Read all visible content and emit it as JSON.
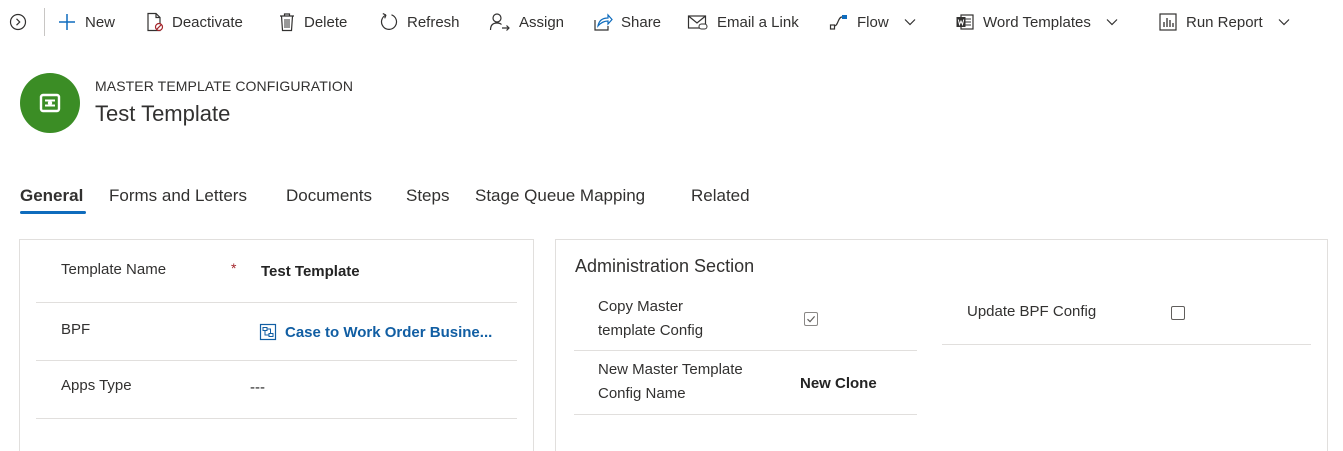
{
  "toolbar": {
    "new_label": "New",
    "deactivate_label": "Deactivate",
    "delete_label": "Delete",
    "refresh_label": "Refresh",
    "assign_label": "Assign",
    "share_label": "Share",
    "email_link_label": "Email a Link",
    "flow_label": "Flow",
    "word_templates_label": "Word Templates",
    "run_report_label": "Run Report"
  },
  "header": {
    "entity_type": "MASTER TEMPLATE CONFIGURATION",
    "record_name": "Test Template",
    "icon_color": "#3b8d25"
  },
  "tabs": [
    {
      "label": "General",
      "active": true
    },
    {
      "label": "Forms and Letters",
      "active": false
    },
    {
      "label": "Documents",
      "active": false
    },
    {
      "label": "Steps",
      "active": false
    },
    {
      "label": "Stage Queue Mapping",
      "active": false
    },
    {
      "label": "Related",
      "active": false
    }
  ],
  "general_section": {
    "template_name": {
      "label": "Template Name",
      "required_marker": "*",
      "value": "Test Template"
    },
    "bpf": {
      "label": "BPF",
      "value": "Case to Work Order Busine..."
    },
    "apps_type": {
      "label": "Apps Type",
      "value": "---"
    }
  },
  "admin_section": {
    "title": "Administration Section",
    "copy_master": {
      "label_line1": "Copy Master",
      "label_line2": "template Config",
      "checked": true
    },
    "new_name": {
      "label_line1": "New Master Template",
      "label_line2": "Config Name",
      "value": "New Clone"
    },
    "update_bpf": {
      "label": "Update BPF Config",
      "checked": false
    }
  },
  "colors": {
    "accent": "#0f6cbd",
    "link": "#115ea3",
    "required": "#a4262c",
    "entity_icon": "#3b8d25"
  }
}
